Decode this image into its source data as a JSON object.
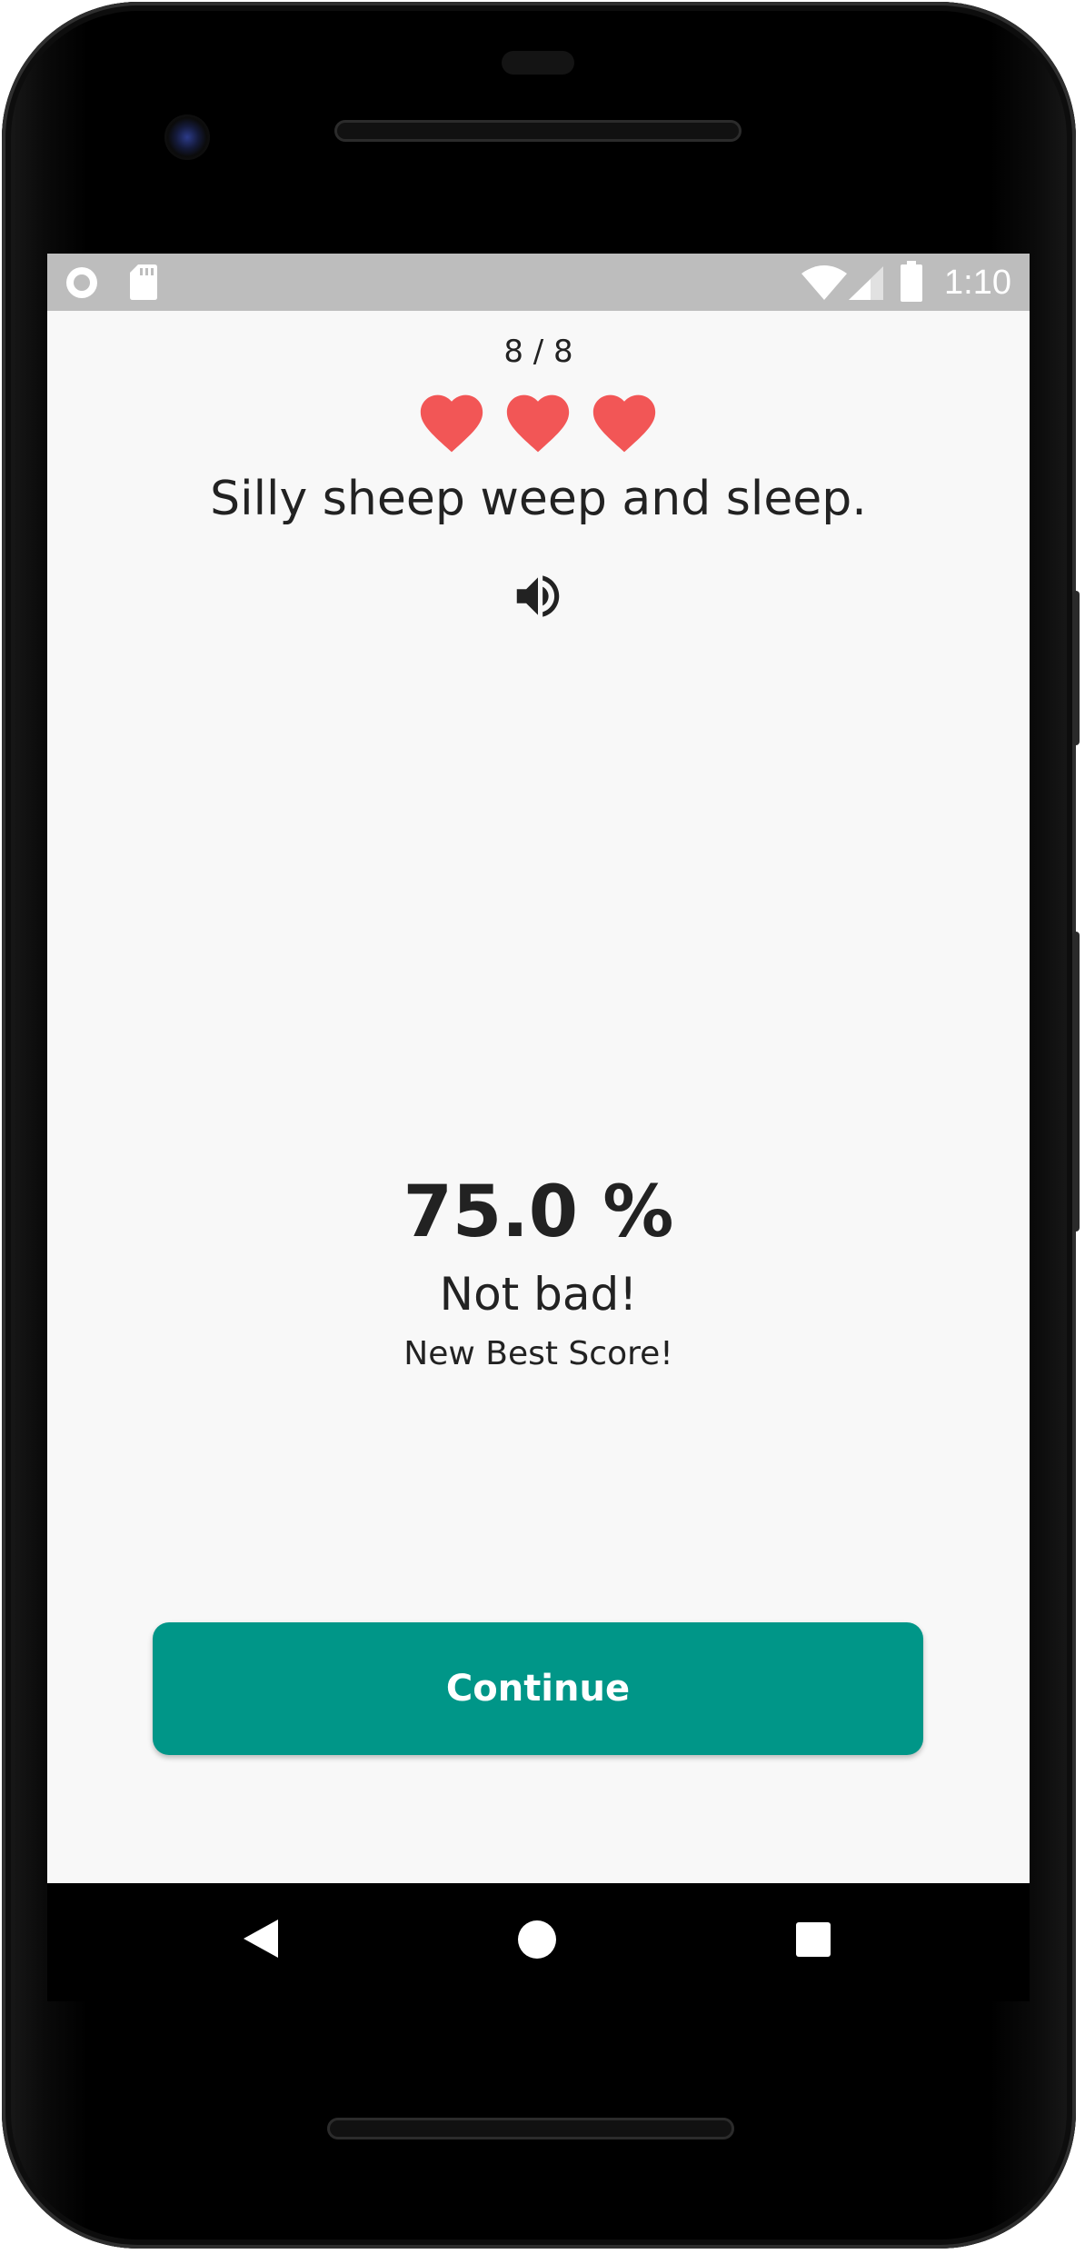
{
  "status_bar": {
    "time": "1:10",
    "left_icons": [
      "circle-icon",
      "sd-card-icon"
    ],
    "right_icons": [
      "wifi-icon",
      "signal-icon",
      "battery-icon"
    ]
  },
  "lesson": {
    "counter": "8 / 8",
    "hearts": 3,
    "heart_color": "#f25656",
    "sentence": "Silly sheep weep and sleep.",
    "audio_icon": "volume-up-icon"
  },
  "result": {
    "score": "75.0 %",
    "verdict": "Not bad!",
    "best_score_note": "New Best Score!"
  },
  "actions": {
    "continue_label": "Continue",
    "accent_color": "#009688"
  },
  "nav_bar": {
    "buttons": [
      "back-icon",
      "home-icon",
      "recents-icon"
    ]
  }
}
